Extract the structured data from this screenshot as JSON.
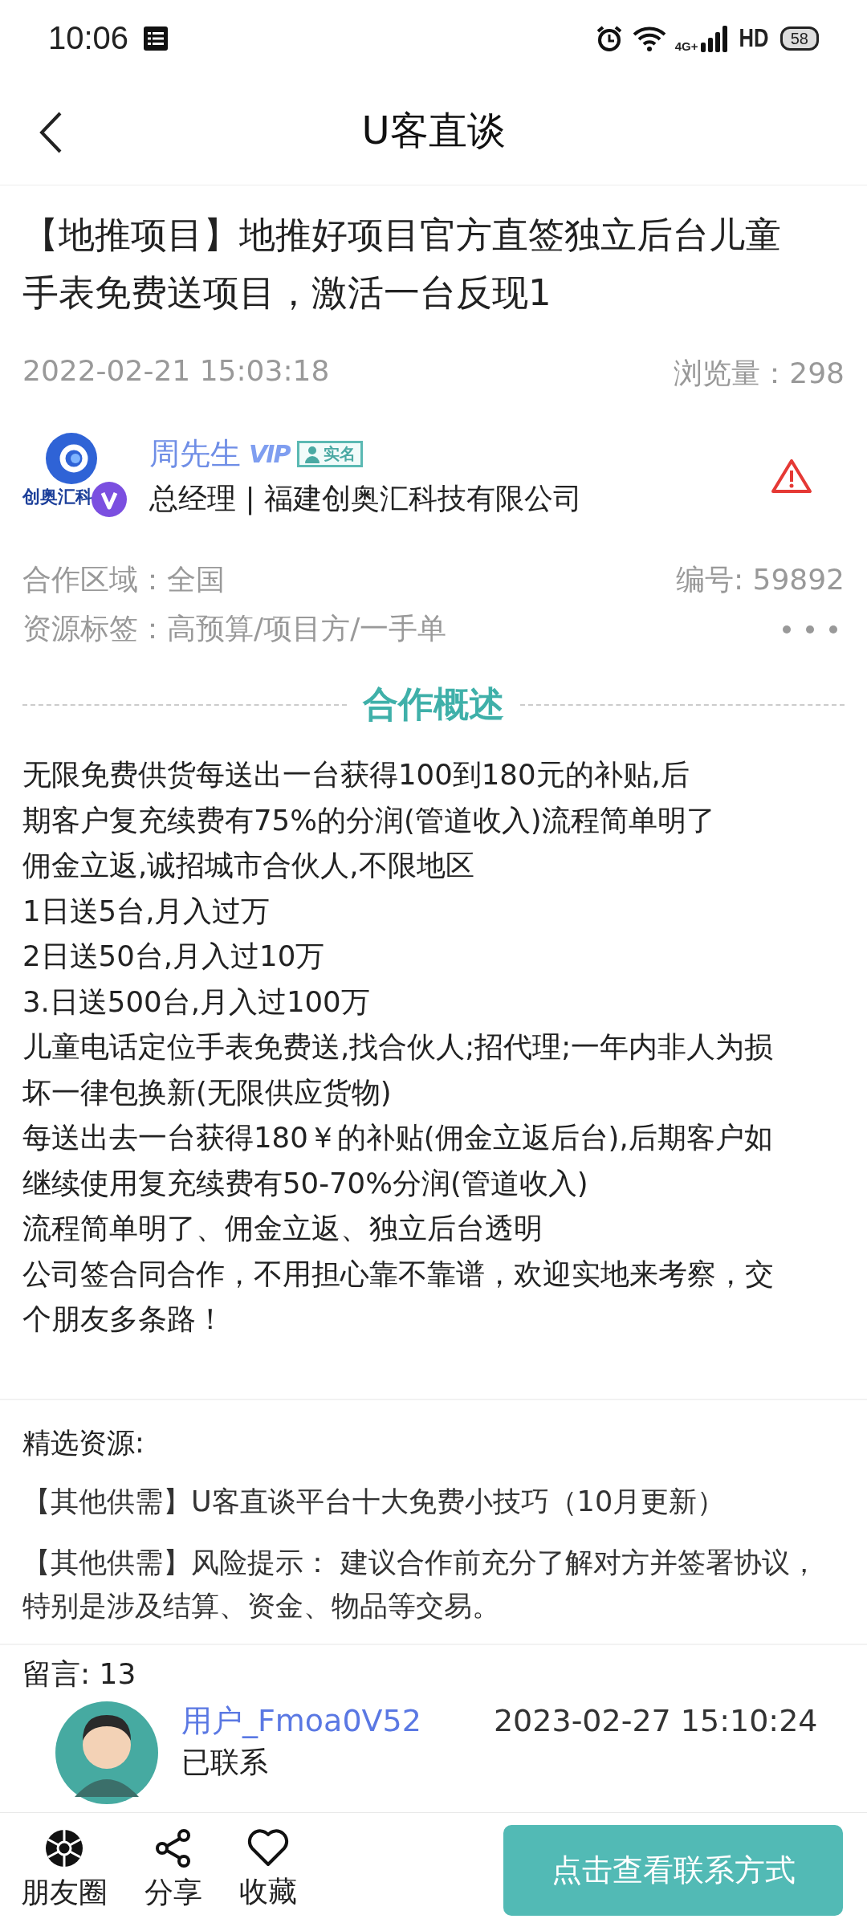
{
  "status_bar": {
    "time": "10:06",
    "network": "4G+",
    "hd": "HD",
    "battery": "58"
  },
  "header": {
    "title": "U客直谈"
  },
  "post": {
    "title_lines": [
      "【地推项目】地推好项目官方直签独立后台儿童",
      "手表免费送项目，激活一台反现1"
    ],
    "date": "2022-02-21 15:03:18",
    "views": "浏览量：298",
    "author": {
      "logo_text": "创奥汇科",
      "name": "周先生",
      "vip": "VIP",
      "verified": "实名",
      "role": "总经理 | 福建创奥汇科技有限公司"
    },
    "area": "合作区域：全国",
    "number": "编号: 59892",
    "tags": "资源标签：高预算/项目方/一手单",
    "section_title": "合作概述",
    "body_lines": [
      "无限免费供货每送出一台获得100到180元的补贴,后",
      "期客户复充续费有75%的分润(管道收入)流程简单明了",
      "佣金立返,诚招城市合伙人,不限地区",
      "1日送5台,月入过万",
      "2日送50台,月入过10万",
      "3.日送500台,月入过100万",
      "儿童电话定位手表免费送,找合伙人;招代理;一年内非人为损",
      "坏一律包换新(无限供应货物)",
      "每送出去一台获得180￥的补贴(佣金立返后台),后期客户如",
      "继续使用复充续费有50-70%分润(管道收入)",
      "流程简单明了、佣金立返、独立后台透明",
      "公司签合同合作，不用担心靠不靠谱，欢迎实地来考察，交",
      "个朋友多条路！"
    ]
  },
  "featured": {
    "label": "精选资源:",
    "items": [
      "【其他供需】U客直谈平台十大免费小技巧（10月更新）",
      "【其他供需】风险提示： 建议合作前充分了解对方并签署协议，特别是涉及结算、资金、物品等交易。"
    ]
  },
  "comments": {
    "count": "留言: 13",
    "items": [
      {
        "user": "用户_Fmoa0V52",
        "time": "2023-02-27 15:10:24",
        "text": "已联系"
      }
    ]
  },
  "bottom_bar": {
    "actions": [
      {
        "kind": "moments",
        "label": "朋友圈"
      },
      {
        "kind": "share",
        "label": "分享"
      },
      {
        "kind": "favorite",
        "label": "收藏"
      }
    ],
    "contact_button": "点击查看联系方式"
  }
}
